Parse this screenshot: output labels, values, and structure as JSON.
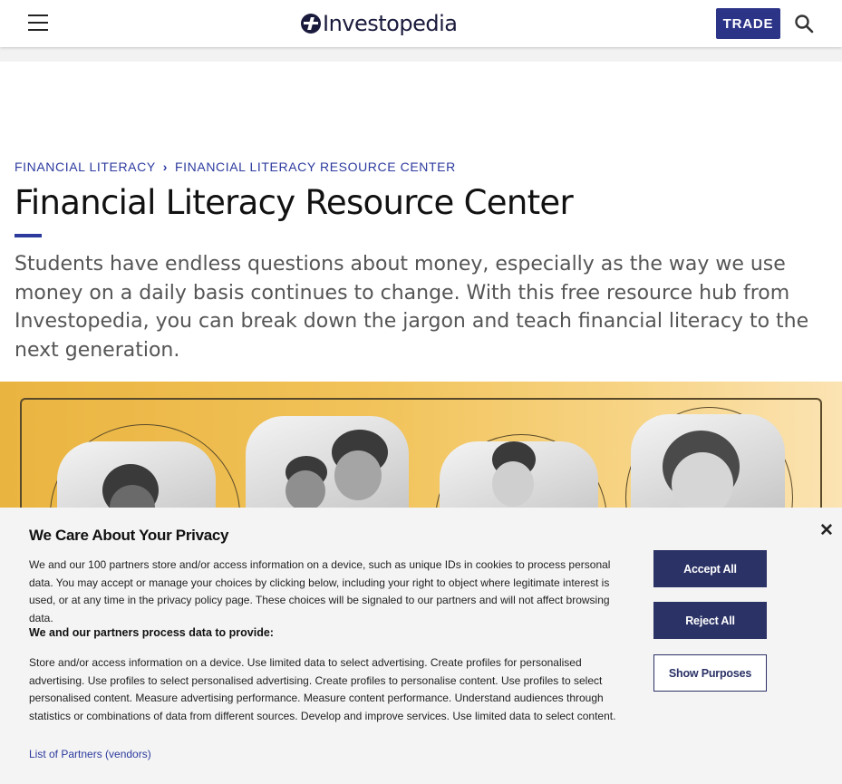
{
  "header": {
    "logo_text": "Investopedia",
    "trade_label": "TRADE"
  },
  "breadcrumb": {
    "items": [
      "FINANCIAL LITERACY",
      "FINANCIAL LITERACY RESOURCE CENTER"
    ]
  },
  "page": {
    "title": "Financial Literacy Resource Center",
    "intro": "Students have endless questions about money, especially as the way we use money on a daily basis continues to change. With this free resource hub from Investopedia, you can break down the jargon and teach financial literacy to the next generation."
  },
  "privacy": {
    "title": "We Care About Your Privacy",
    "body": "We and our 100 partners store and/or access information on a device, such as unique IDs in cookies to process personal data. You may accept or manage your choices by clicking below, including your right to object where legitimate interest is used, or at any time in the privacy policy page. These choices will be signaled to our partners and will not affect browsing data.",
    "subheading": "We and our partners process data to provide:",
    "purposes": "Store and/or access information on a device. Use limited data to select advertising. Create profiles for personalised advertising. Use profiles to select personalised advertising. Create profiles to personalise content. Use profiles to select personalised content. Measure advertising performance. Measure content performance. Understand audiences through statistics or combinations of data from different sources. Develop and improve services. Use limited data to select content.",
    "partners_link": "List of Partners (vendors)",
    "accept_label": "Accept All",
    "reject_label": "Reject All",
    "purposes_label": "Show Purposes",
    "close_glyph": "✕"
  },
  "colors": {
    "brand_navy": "#2c3487",
    "link_blue": "#2c3a9e",
    "hero_gold": "#eab440"
  }
}
